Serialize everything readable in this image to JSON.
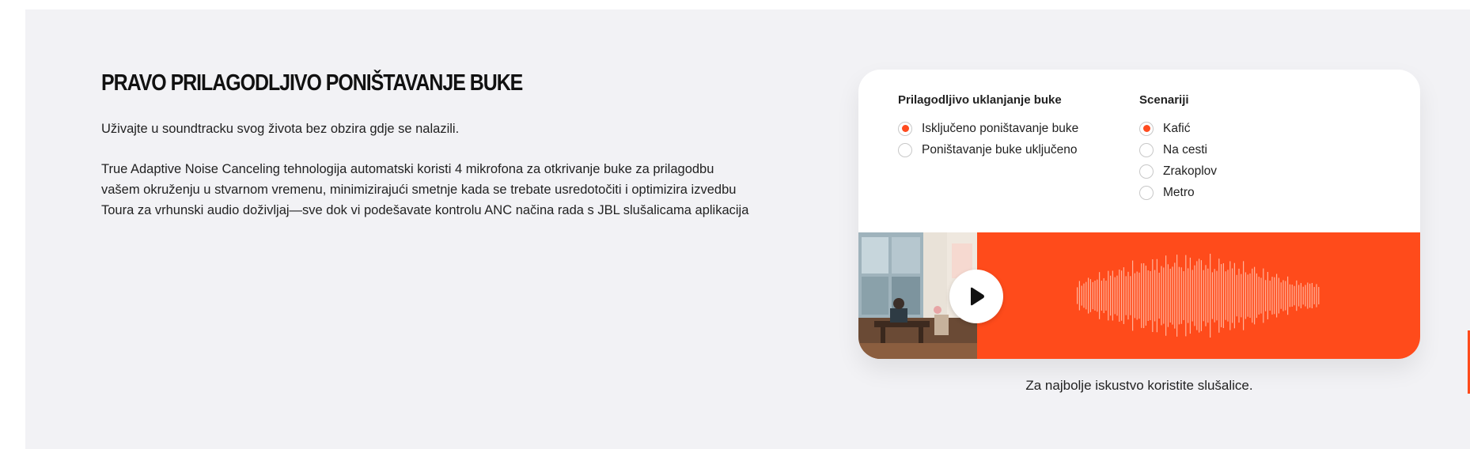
{
  "section": {
    "title": "PRAVO PRILAGODLJIVO PONIŠTAVANJE BUKE",
    "intro": "Uživajte u soundtracku svog života bez obzira gdje se nalazili.",
    "body": "True Adaptive Noise Canceling tehnologija automatski koristi 4 mikrofona za otkrivanje buke za prilagodbu vašem okruženju u stvarnom vremenu, minimizirajući smetnje kada se trebate usredotočiti i optimizira izvedbu Toura za vrhunski audio doživljaj—sve dok vi podešavate kontrolu ANC načina rada s JBL slušalicama aplikacija"
  },
  "demo": {
    "noise": {
      "heading": "Prilagodljivo uklanjanje buke",
      "options": [
        {
          "label": "Isključeno poništavanje buke",
          "selected": true
        },
        {
          "label": "Poništavanje buke uključeno",
          "selected": false
        }
      ]
    },
    "scenarios": {
      "heading": "Scenariji",
      "options": [
        {
          "label": "Kafić",
          "selected": true
        },
        {
          "label": "Na cesti",
          "selected": false
        },
        {
          "label": "Zrakoplov",
          "selected": false
        },
        {
          "label": "Metro",
          "selected": false
        }
      ]
    },
    "player": {
      "play_icon": "play-icon",
      "accent_color": "#ff4b1b",
      "wave_color": "#ffb39b"
    },
    "caption": "Za najbolje iskustvo koristite slušalice."
  }
}
